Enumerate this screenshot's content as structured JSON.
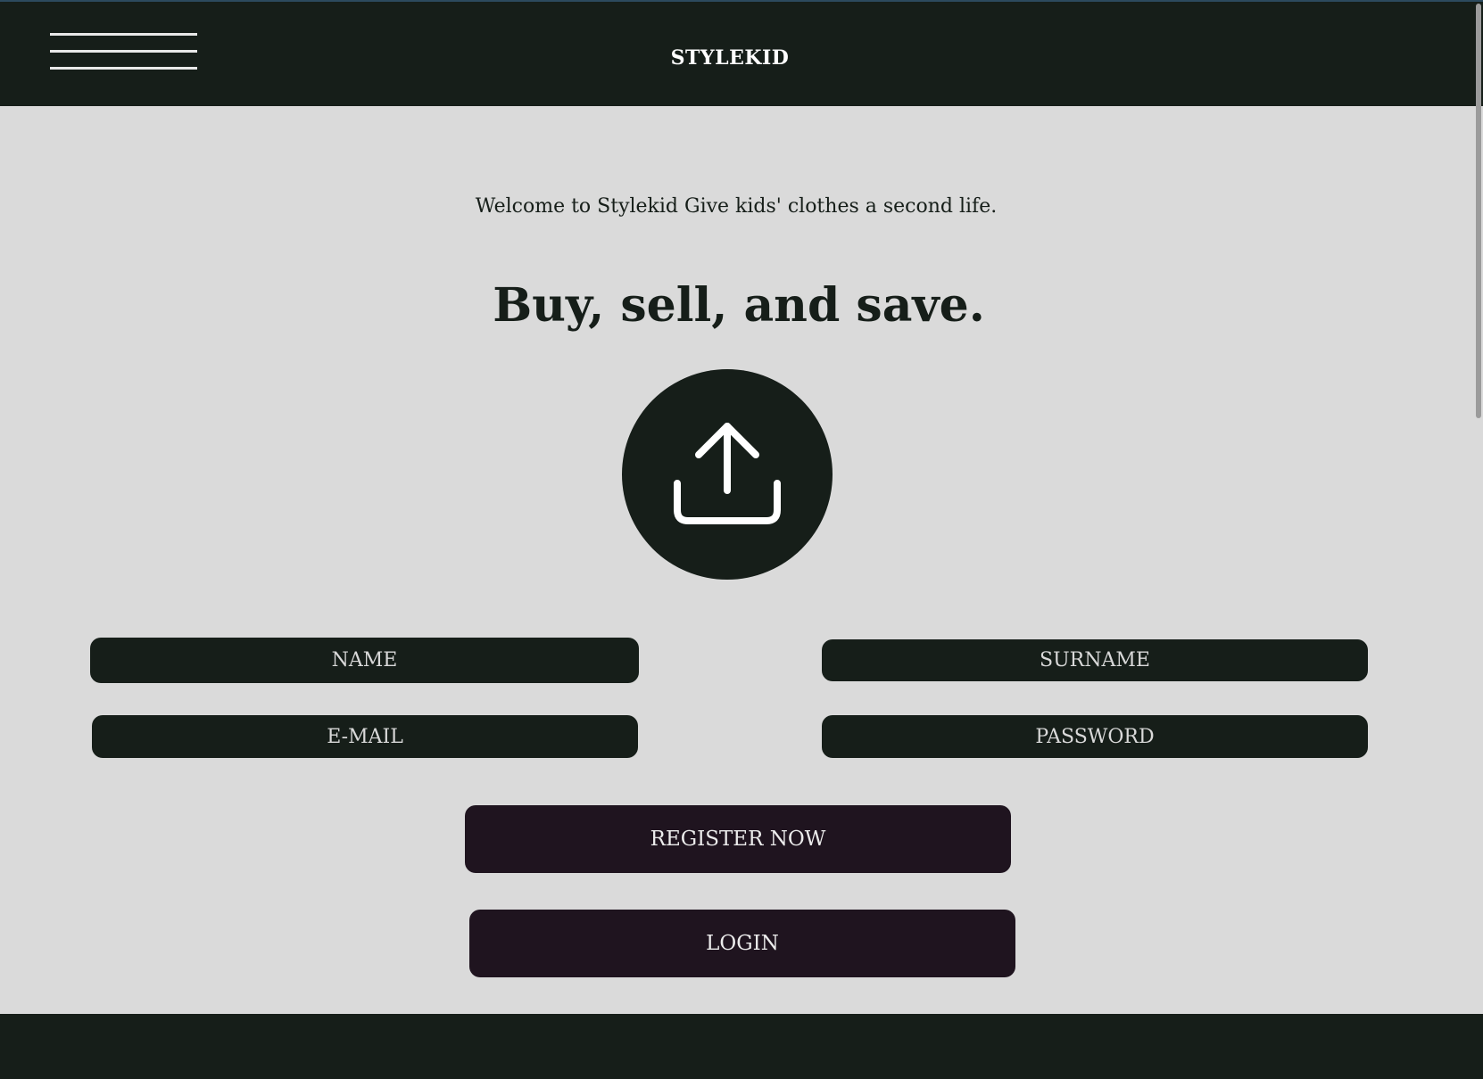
{
  "header": {
    "brand": "STYLEKID",
    "menu_icon": "hamburger-menu-icon"
  },
  "main": {
    "welcome_text": "Welcome to Stylekid Give kids' clothes a second life.",
    "headline": "Buy, sell, and save.",
    "upload_icon": "upload-icon"
  },
  "form": {
    "name_placeholder": "NAME",
    "surname_placeholder": "SURNAME",
    "email_placeholder": "E-MAIL",
    "password_placeholder": "PASSWORD",
    "register_label": "REGISTER NOW",
    "login_label": "LOGIN"
  },
  "colors": {
    "header_bg": "#161e19",
    "page_bg": "#dadada",
    "field_bg": "#161e19",
    "button_bg": "#1f141f"
  }
}
